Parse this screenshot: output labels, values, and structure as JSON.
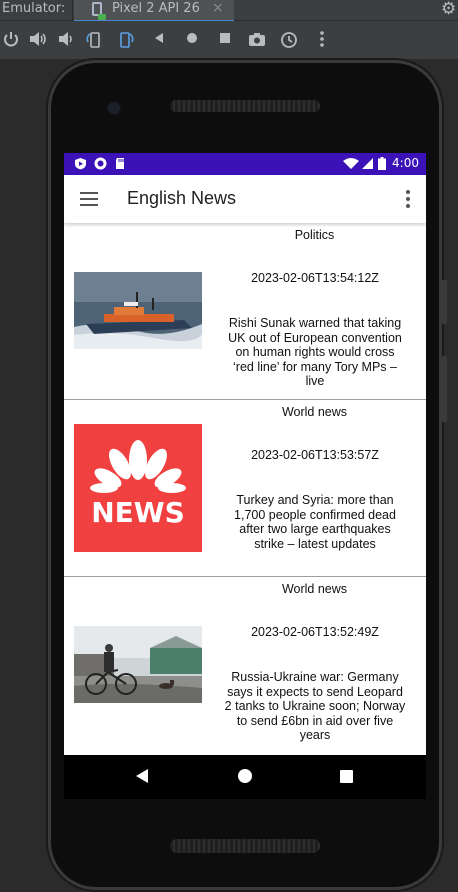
{
  "emulator": {
    "label": "Emulator:",
    "tab_title": "Pixel 2 API 26",
    "tab_close": "×",
    "toolbar_icons": [
      "power-icon",
      "volume-up-icon",
      "volume-down-icon",
      "rotate-left-icon",
      "rotate-right-icon",
      "back-icon",
      "home-icon",
      "overview-icon",
      "screenshot-icon",
      "snapshot-icon",
      "more-icon"
    ]
  },
  "statusbar": {
    "time": "4:00"
  },
  "appbar": {
    "title": "English News"
  },
  "articles": [
    {
      "category": "Politics",
      "date": "2023-02-06T13:54:12Z",
      "title": "Rishi Sunak warned that taking UK out of European convention on human rights would cross ‘red line’ for many Tory MPs – live",
      "image": "lifeboat-photo"
    },
    {
      "category": "World news",
      "date": "2023-02-06T13:53:57Z",
      "title": "Turkey and Syria: more than 1,700 people confirmed dead after two large earthquakes strike – latest updates",
      "image": "nbc-news-logo",
      "image_text": "NEWS"
    },
    {
      "category": "World news",
      "date": "2023-02-06T13:52:49Z",
      "title": "Russia-Ukraine war: Germany says it expects to send Leopard 2 tanks to Ukraine soon; Norway to send £6bn in aid over five years",
      "image": "cyclist-photo"
    }
  ],
  "colors": {
    "statusbar": "#3b12b8",
    "nbc_red": "#f04140",
    "emulator_bg": "#3c3f41"
  }
}
